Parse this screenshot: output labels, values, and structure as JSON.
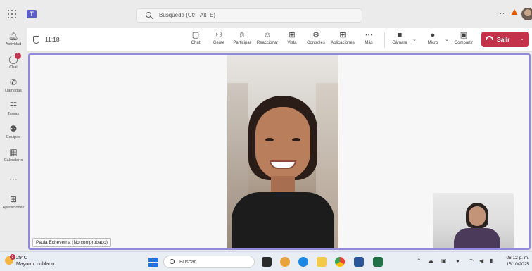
{
  "topbar": {
    "search_placeholder": "Búsqueda (Ctrl+Alt+E)",
    "more_label": "···"
  },
  "rail": {
    "items": [
      {
        "label": "Actividad",
        "icon": "bell-icon"
      },
      {
        "label": "Chat",
        "icon": "chat-icon",
        "badge": "1"
      },
      {
        "label": "Llamadas",
        "icon": "phone-icon"
      },
      {
        "label": "Tareas",
        "icon": "tasks-icon"
      },
      {
        "label": "Equipos",
        "icon": "teams-icon"
      },
      {
        "label": "Calendario",
        "icon": "calendar-icon"
      },
      {
        "label": "···",
        "icon": "more-icon"
      },
      {
        "label": "Aplicaciones",
        "icon": "apps-add-icon"
      }
    ]
  },
  "meeting": {
    "timer": "11:18",
    "tools": [
      {
        "label": "Chat",
        "icon": "chat-icon"
      },
      {
        "label": "Gente",
        "icon": "people-icon"
      },
      {
        "label": "Participar",
        "icon": "raise-hand-icon"
      },
      {
        "label": "Reaccionar",
        "icon": "emoji-icon"
      },
      {
        "label": "Vista",
        "icon": "view-icon"
      },
      {
        "label": "Controles",
        "icon": "controls-icon"
      },
      {
        "label": "Aplicaciones",
        "icon": "apps-icon"
      },
      {
        "label": "Más",
        "icon": "more-icon"
      }
    ],
    "devices": [
      {
        "label": "Cámara",
        "icon": "camera-icon"
      },
      {
        "label": "Micro",
        "icon": "mic-icon"
      },
      {
        "label": "Compartir",
        "icon": "share-icon"
      }
    ],
    "leave_label": "Salir",
    "leave_color": "#c4314b",
    "participant_name": "Paula Echeverria (No comprobado)"
  },
  "taskbar": {
    "weather_temp": "29°C",
    "weather_desc": "Mayorm. nublado",
    "weather_badge": "2",
    "search_label": "Buscar",
    "time": "06:12 p. m.",
    "date": "15/10/2025"
  },
  "colors": {
    "accent": "#5b5fc7",
    "stage_border": "#8f8bd8",
    "leave": "#c4314b"
  }
}
